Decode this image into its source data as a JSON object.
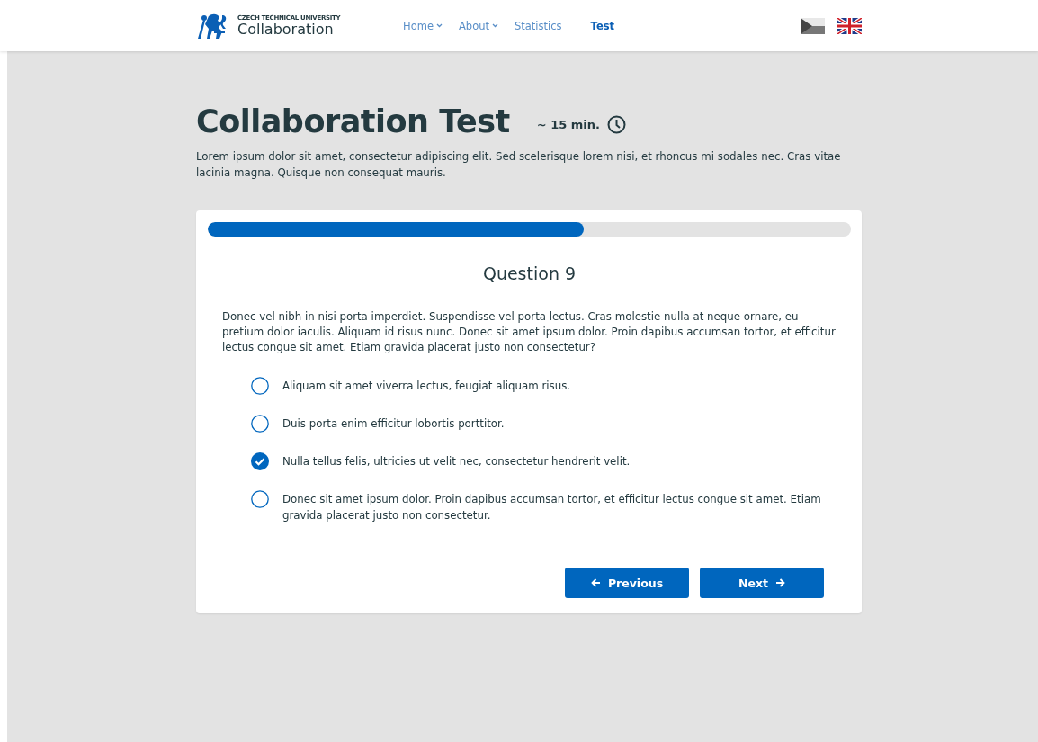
{
  "header": {
    "logo": {
      "small": "CZECH TECHNICAL UNIVERSITY",
      "name": "Collaboration"
    },
    "nav": [
      {
        "label": "Home",
        "dropdown": true,
        "selected": false
      },
      {
        "label": "About",
        "dropdown": true,
        "selected": false
      },
      {
        "label": "Statistics",
        "dropdown": false,
        "selected": false
      },
      {
        "label": "Test",
        "dropdown": false,
        "selected": true
      }
    ]
  },
  "intro": {
    "title": "Collaboration Test",
    "duration": "~ 15 min.",
    "description": "Lorem ipsum dolor sit amet, consectetur adipiscing elit. Sed scelerisque lorem nisi, et rhoncus mi sodales nec. Cras vitae lacinia magna. Quisque non consequat mauris."
  },
  "card": {
    "progress": {
      "level": 0.584
    },
    "question_title": "Question 9",
    "question": "Donec vel nibh in nisi porta imperdiet. Suspendisse vel porta lectus. Cras molestie nulla at neque ornare, eu pretium dolor iaculis. Aliquam id risus nunc. Donec sit amet ipsum dolor. Proin dapibus accumsan tortor, et efficitur lectus congue sit amet. Etiam gravida placerat justo non consectetur?",
    "options": [
      {
        "label": "Aliquam sit amet viverra lectus, feugiat aliquam risus.",
        "selected": false
      },
      {
        "label": "Duis porta enim efficitur lobortis porttitor.",
        "selected": false
      },
      {
        "label": "Nulla tellus felis, ultricies ut velit nec, consectetur hendrerit velit.",
        "selected": true
      },
      {
        "label": "Donec sit amet ipsum dolor. Proin dapibus accumsan tortor, et efficitur lectus congue sit amet. Etiam gravida placerat justo non consectetur.",
        "selected": false
      }
    ],
    "buttons": [
      {
        "label": "Previous",
        "kind": "back"
      },
      {
        "label": "Next",
        "kind": "forward"
      }
    ]
  }
}
